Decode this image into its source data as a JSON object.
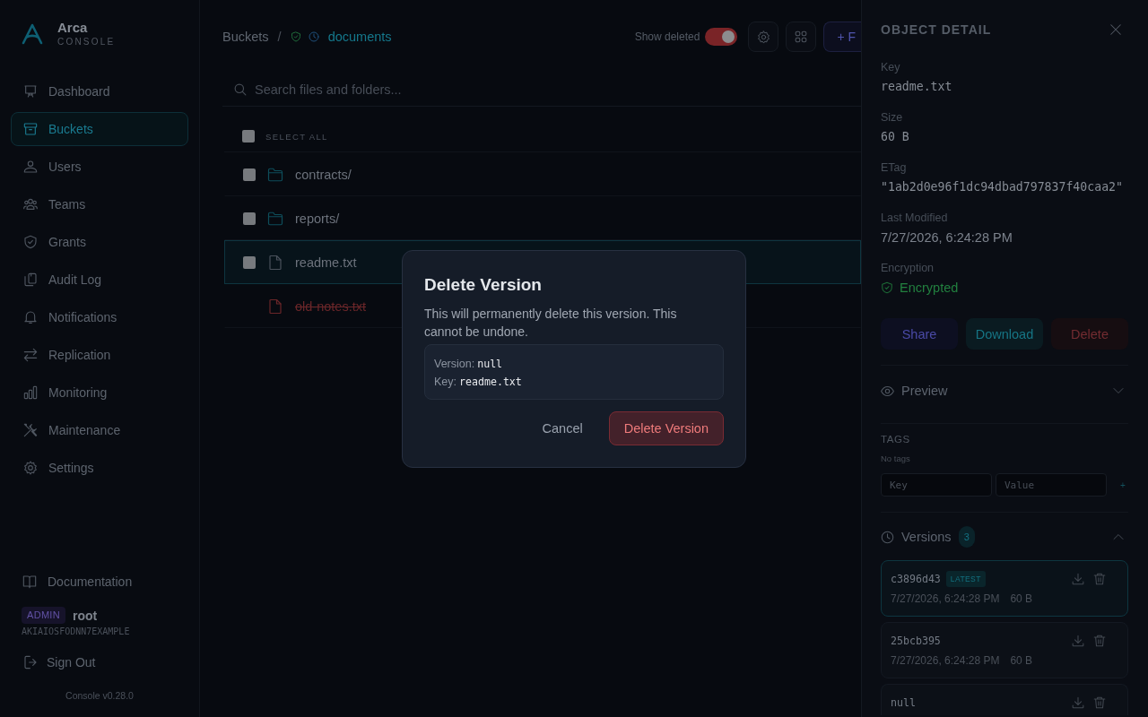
{
  "sidebar": {
    "brand": {
      "name": "Arca",
      "subtitle": "CONSOLE"
    },
    "nav": [
      {
        "label": "Dashboard",
        "selected": false
      },
      {
        "label": "Buckets",
        "selected": true
      },
      {
        "label": "Users",
        "selected": false
      },
      {
        "label": "Teams",
        "selected": false
      },
      {
        "label": "Grants",
        "selected": false
      },
      {
        "label": "Audit Log",
        "selected": false
      },
      {
        "label": "Notifications",
        "selected": false
      },
      {
        "label": "Replication",
        "selected": false
      },
      {
        "label": "Monitoring",
        "selected": false
      },
      {
        "label": "Maintenance",
        "selected": false
      },
      {
        "label": "Settings",
        "selected": false
      }
    ],
    "documentation": "Documentation",
    "user": {
      "role": "ADMIN",
      "name": "root",
      "access_key": "AKIAIOSFODNN7EXAMPLE"
    },
    "sign_out": "Sign Out",
    "version": "Console v0.28.0"
  },
  "breadcrumb": {
    "root": "Buckets",
    "separator": "/",
    "bucket": "documents"
  },
  "toolbar": {
    "show_deleted": {
      "label": "Show deleted",
      "on": true
    },
    "new_button": "+ F"
  },
  "search": {
    "placeholder": "Search files and folders..."
  },
  "table": {
    "select_all": {
      "label": "SELECT ALL",
      "checked": false
    },
    "rows": [
      {
        "kind": "folder",
        "name": "contracts/",
        "checked": false,
        "selected": false,
        "deleted": false
      },
      {
        "kind": "folder",
        "name": "reports/",
        "checked": false,
        "selected": false,
        "deleted": false
      },
      {
        "kind": "file",
        "name": "readme.txt",
        "checked": false,
        "selected": true,
        "deleted": false
      },
      {
        "kind": "file",
        "name": "old-notes.txt",
        "selected": false,
        "deleted": true
      }
    ]
  },
  "detail_panel": {
    "title": "OBJECT DETAIL",
    "fields": [
      {
        "label": "Key",
        "value": "readme.txt",
        "kind": "mono"
      },
      {
        "label": "Size",
        "value": "60 B",
        "kind": "mono"
      },
      {
        "label": "ETag",
        "value": "\"1ab2d0e96f1dc94dbad797837f40caa2\"",
        "kind": "mono"
      },
      {
        "label": "Last Modified",
        "value": "7/27/2026, 6:24:28 PM",
        "kind": "text"
      },
      {
        "label": "Encryption",
        "value": "Encrypted",
        "kind": "status"
      }
    ],
    "actions": [
      {
        "label": "Share",
        "kind": "share"
      },
      {
        "label": "Download",
        "kind": "download"
      },
      {
        "label": "Delete",
        "kind": "delete"
      }
    ],
    "preview": {
      "label": "Preview",
      "expanded": false
    },
    "tags": {
      "title": "TAGS",
      "empty": "No tags",
      "key_placeholder": "Key",
      "value_placeholder": "Value",
      "add": "+"
    },
    "versions": {
      "label": "Versions",
      "count": "3",
      "expanded": true,
      "items": [
        {
          "id": "c3896d43",
          "badge": "LATEST",
          "date": "7/27/2026, 6:24:28 PM",
          "size": "60 B",
          "selected": true
        },
        {
          "id": "25bcb395",
          "date": "7/27/2026, 6:24:28 PM",
          "size": "60 B",
          "selected": false
        },
        {
          "id": "null",
          "selected": false
        }
      ]
    }
  },
  "modal": {
    "title": "Delete Version",
    "message": "This will permanently delete this version. This cannot be undone.",
    "details": [
      {
        "label": "Version:",
        "value": "null"
      },
      {
        "label": "Key:",
        "value": "readme.txt"
      }
    ],
    "buttons": [
      {
        "label": "Cancel",
        "kind": "secondary"
      },
      {
        "label": "Delete Version",
        "kind": "danger"
      }
    ]
  }
}
